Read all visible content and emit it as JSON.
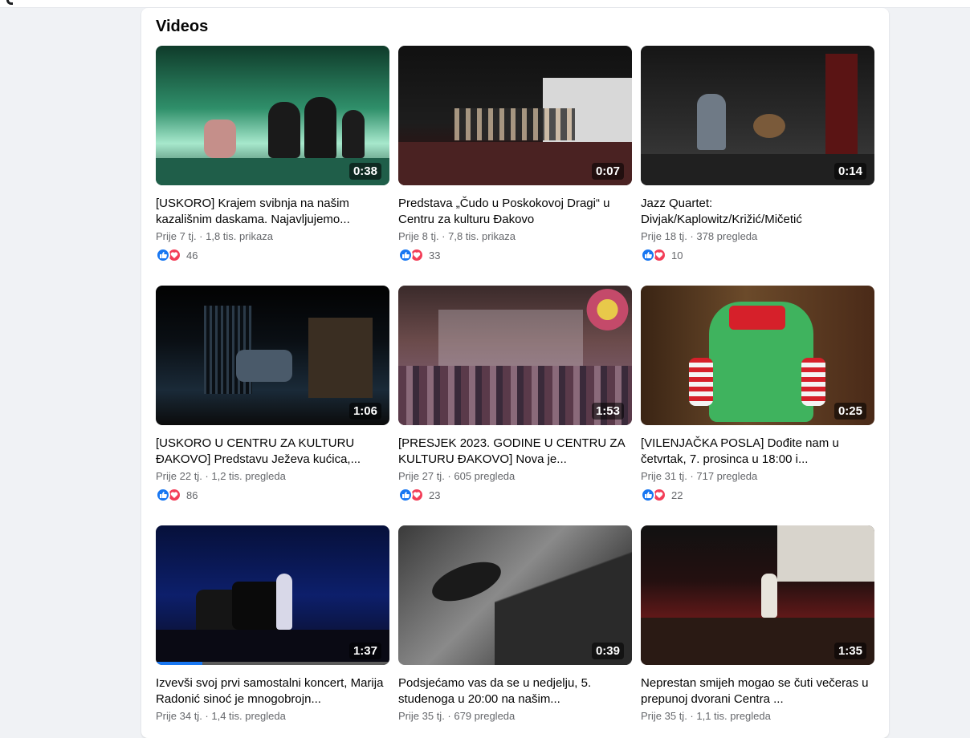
{
  "section": {
    "title": "Videos"
  },
  "videos": [
    {
      "title": "[USKORO] Krajem svibnja na našim kazališnim daskama. Najavljujemo...",
      "duration": "0:38",
      "meta": "Prije 7 tj. · 1,8 tis. prikaza",
      "reactions": "46"
    },
    {
      "title": "Predstava „Čudo u Poskokovoj Dragi“ u Centru za kulturu Đakovo",
      "duration": "0:07",
      "meta": "Prije 8 tj. · 7,8 tis. prikaza",
      "reactions": "33"
    },
    {
      "title": "Jazz Quartet: Divjak/Kaplowitz/Križić/Mičetić",
      "duration": "0:14",
      "meta": "Prije 18 tj. · 378 pregleda",
      "reactions": "10"
    },
    {
      "title": "[USKORO U CENTRU ZA KULTURU ĐAKOVO] Predstavu Ježeva kućica,...",
      "duration": "1:06",
      "meta": "Prije 22 tj. · 1,2 tis. pregleda",
      "reactions": "86"
    },
    {
      "title": "[PRESJEK 2023. GODINE U CENTRU ZA KULTURU ĐAKOVO] Nova je...",
      "duration": "1:53",
      "meta": "Prije 27 tj. · 605 pregleda",
      "reactions": "23"
    },
    {
      "title": "[VILENJAČKA POSLA] Dođite nam u četvrtak, 7. prosinca u 18:00 i...",
      "duration": "0:25",
      "meta": "Prije 31 tj. · 717 pregleda",
      "reactions": "22"
    },
    {
      "title": "Izvevši svoj prvi samostalni koncert, Marija Radonić sinoć je mnogobrojn...",
      "duration": "1:37",
      "meta": "Prije 34 tj. · 1,4 tis. pregleda",
      "watched_fraction": 0.2
    },
    {
      "title": "Podsjećamo vas da se u nedjelju, 5. studenoga u 20:00 na našim...",
      "duration": "0:39",
      "meta": "Prije 35 tj. · 679 pregleda"
    },
    {
      "title": "Neprestan smijeh mogao se čuti večeras u prepunoj dvorani Centra ...",
      "duration": "1:35",
      "meta": "Prije 35 tj. · 1,1 tis. pregleda"
    }
  ],
  "colors": {
    "like": "#1877f2",
    "love": "#f33e58",
    "meta_text": "#65676b"
  },
  "icons": {
    "like": "thumbs-up-icon",
    "love": "heart-icon"
  }
}
